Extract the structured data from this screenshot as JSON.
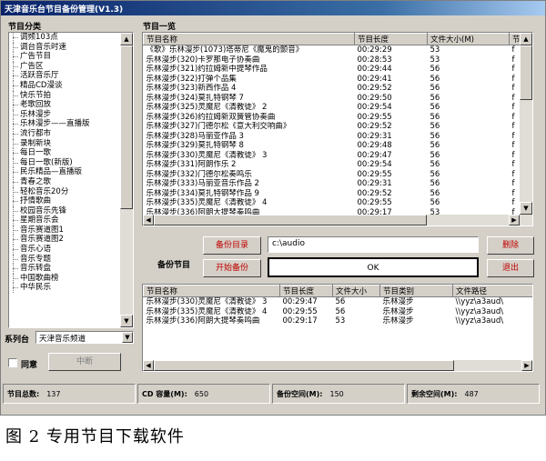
{
  "window": {
    "title": "天津音乐台节目备份管理(V1.3)"
  },
  "category_section": {
    "label": "节目分类"
  },
  "categories": [
    "调频103点",
    "调台音乐时速",
    "广告节目",
    "广告区",
    "活跃音乐厅",
    "精品CD漫谈",
    "快乐节拍",
    "老歌回放",
    "乐林漫步",
    "乐林漫步——直播版",
    "流行都市",
    "录制新块",
    "每日一歌",
    "每日一歌(新版)",
    "民乐精品—直播版",
    "青春之歌",
    "轻松音乐20分",
    "抒情歌曲",
    "校园音乐先锋",
    "星期音乐会",
    "音乐赛道图1",
    "音乐赛道图2",
    "音乐心语",
    "音乐专题",
    "音乐转盘",
    "中国歌曲榜",
    "中华民乐"
  ],
  "series": {
    "label": "系列台",
    "selected": "天津音乐频道"
  },
  "agree": {
    "label": "同意",
    "checked": false
  },
  "stop_button": {
    "label": "中断"
  },
  "program_section": {
    "label": "节目一览"
  },
  "program_table": {
    "columns": [
      "节目名称",
      "节目长度",
      "文件大小(M)",
      "节"
    ],
    "rows": [
      [
        "《歌》乐林漫步(1073)塔蒂尼《魔鬼的颤音》",
        "00:29:29",
        "53",
        "f"
      ],
      [
        "乐林漫步(320)卡罗那电子协奏曲",
        "00:28:53",
        "53",
        "f"
      ],
      [
        "乐林漫步(321)约拉姆新中提琴作品",
        "00:29:44",
        "56",
        "f"
      ],
      [
        "乐林漫步(322)打弹个品集",
        "00:29:41",
        "56",
        "f"
      ],
      [
        "乐林漫步(323)新西作品 4",
        "00:29:52",
        "56",
        "f"
      ],
      [
        "乐林漫步(324)莫扎特钢琴 7",
        "00:29:50",
        "56",
        "f"
      ],
      [
        "乐林漫步(325)灵魔尼《清教徒》 2",
        "00:29:54",
        "56",
        "f"
      ],
      [
        "乐林漫步(326)约拉姆新双簧管协奏曲",
        "00:29:55",
        "56",
        "f"
      ],
      [
        "乐林漫步(327)门德尔松《意大利交响曲》",
        "00:29:52",
        "56",
        "f"
      ],
      [
        "乐林漫步(328)马丽亚作品 3",
        "00:29:31",
        "56",
        "f"
      ],
      [
        "乐林漫步(329)莫扎特钢琴 8",
        "00:29:48",
        "56",
        "f"
      ],
      [
        "乐林漫步(330)灵魔尼《清教徒》 3",
        "00:29:47",
        "56",
        "f"
      ],
      [
        "乐林漫步(331)阿朗作乐 2",
        "00:29:54",
        "56",
        "f"
      ],
      [
        "乐林漫步(332)门德尔松奏鸣乐",
        "00:29:55",
        "56",
        "f"
      ],
      [
        "乐林漫步(333)马丽亚音乐作品 2",
        "00:29:31",
        "56",
        "f"
      ],
      [
        "乐林漫步(334)莫扎特钢琴作品 9",
        "00:29:52",
        "56",
        "f"
      ],
      [
        "乐林漫步(335)灵魔尼《清教徒》 4",
        "00:29:55",
        "56",
        "f"
      ],
      [
        "乐林漫步(336)阿朗大提琴奏鸣曲",
        "00:29:17",
        "53",
        "f"
      ]
    ]
  },
  "backup_section": {
    "label": "备份节目",
    "dir_button": "备份目录",
    "start_button": "开始备份",
    "dir_value": "c:\\audio",
    "status": "OK",
    "delete_button": "删除",
    "exit_button": "退出"
  },
  "download_table": {
    "columns": [
      "节目名称",
      "节目长度",
      "文件大小",
      "节目类别",
      "文件路径"
    ],
    "rows": [
      [
        "乐林漫步(330)灵魔尼《清教徒》 3",
        "00:29:47",
        "56",
        "乐林漫步",
        "\\\\yyz\\a3aud\\"
      ],
      [
        "乐林漫步(335)灵魔尼《清教徒》 4",
        "00:29:55",
        "56",
        "乐林漫步",
        "\\\\yyz\\a3aud\\"
      ],
      [
        "乐林漫步(336)阿朗大提琴奏鸣曲",
        "00:29:17",
        "53",
        "乐林漫步",
        "\\\\yyz\\a3aud\\"
      ]
    ]
  },
  "statusbar": [
    {
      "label": "节目总数:",
      "value": "137"
    },
    {
      "label": "CD 容量(M):",
      "value": "650"
    },
    {
      "label": "备份空间(M):",
      "value": "150"
    },
    {
      "label": "剩余空间(M):",
      "value": "487"
    }
  ],
  "caption": "图 2   专用节目下载软件"
}
